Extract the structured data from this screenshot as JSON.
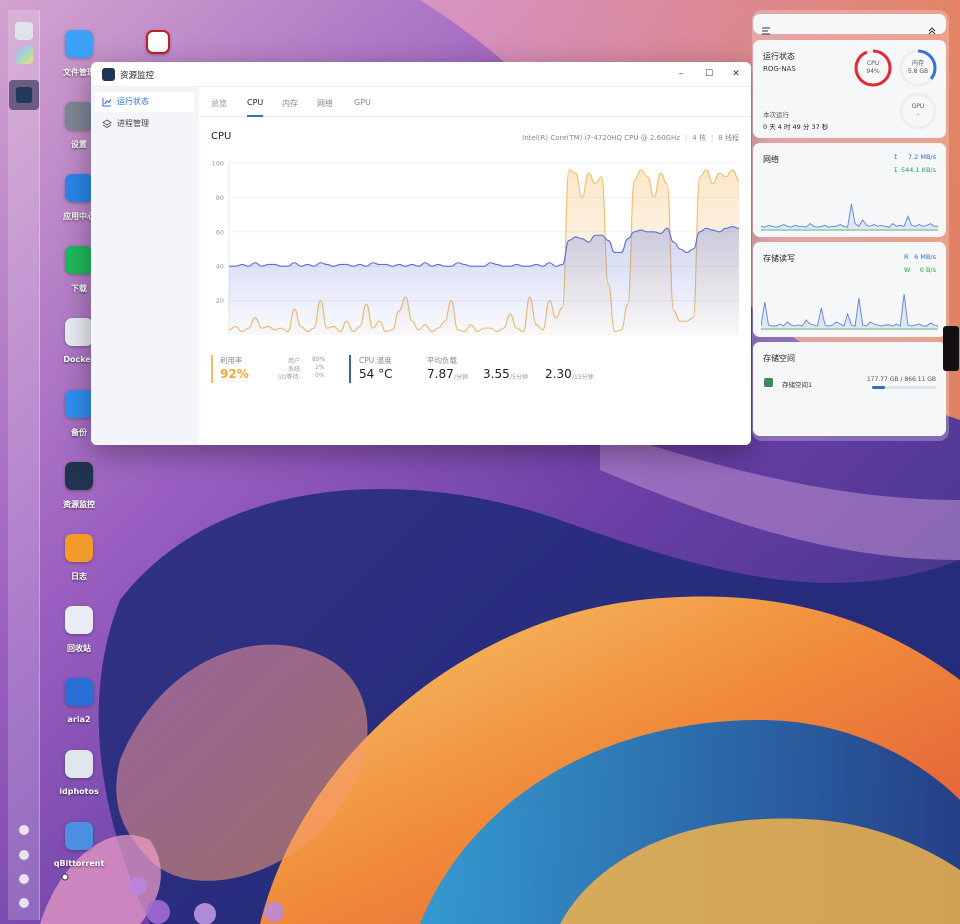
{
  "window": {
    "title": "资源监控",
    "controls": {
      "minimize": "–",
      "maximize": "☐",
      "close": "✕"
    }
  },
  "sidebar": {
    "items": [
      {
        "label": "运行状态",
        "icon": "chart-line-icon",
        "active": true
      },
      {
        "label": "进程管理",
        "icon": "layers-icon",
        "active": false
      }
    ]
  },
  "tabs": [
    {
      "label": "总览",
      "active": false
    },
    {
      "label": "CPU",
      "active": true
    },
    {
      "label": "内存",
      "active": false
    },
    {
      "label": "网络",
      "active": false
    },
    {
      "label": "GPU",
      "active": false
    }
  ],
  "cpu": {
    "title": "CPU",
    "model": "Intel(R) Core(TM) i7-4720HQ CPU @ 2.60GHz",
    "cores": "4 核",
    "threads": "8 线程",
    "usage_label": "利用率",
    "usage_value": "92%",
    "user_label": "用户:",
    "user_value": "89%",
    "system_label": "系统:",
    "system_value": "2%",
    "io_label": "I/O等待:",
    "io_value": "0%",
    "temp_label": "CPU 温度",
    "temp_value": "54 °C",
    "load_label": "平均负载",
    "load": [
      {
        "value": "7.87",
        "unit": "/分钟"
      },
      {
        "value": "3.55",
        "unit": "/5分钟"
      },
      {
        "value": "2.30",
        "unit": "/15分钟"
      }
    ]
  },
  "chart_data": {
    "type": "area",
    "y_ticks": [
      "100",
      "80",
      "60",
      "40",
      "20"
    ],
    "ylim": [
      0,
      100
    ],
    "grid": true,
    "series": [
      {
        "color": "#f2bd6a",
        "values": [
          3,
          5,
          2,
          4,
          10,
          4,
          5,
          3,
          4,
          2,
          15,
          5,
          2,
          4,
          20,
          4,
          5,
          2,
          8,
          2,
          5,
          18,
          4,
          8,
          2,
          3,
          14,
          22,
          8,
          3,
          6,
          2,
          4,
          8,
          20,
          3,
          2,
          6,
          2,
          4,
          4,
          2,
          4,
          12,
          4,
          2,
          22,
          6,
          3,
          20,
          10,
          16,
          96,
          94,
          80,
          94,
          88,
          92,
          30,
          2,
          3,
          18,
          90,
          96,
          92,
          80,
          94,
          88,
          14,
          8,
          8,
          10,
          92,
          96,
          88,
          94,
          92,
          96,
          90
        ]
      },
      {
        "color": "#5b6fd9",
        "values": [
          40,
          40,
          41,
          40,
          42,
          40,
          41,
          41,
          40,
          40,
          42,
          40,
          41,
          40,
          42,
          41,
          40,
          41,
          41,
          40,
          41,
          40,
          42,
          41,
          41,
          40,
          41,
          40,
          41,
          40,
          42,
          40,
          41,
          40,
          40,
          42,
          41,
          40,
          40,
          40,
          42,
          41,
          40,
          40,
          41,
          40,
          40,
          41,
          40,
          42,
          40,
          41,
          55,
          57,
          56,
          54,
          58,
          58,
          55,
          48,
          48,
          56,
          60,
          61,
          60,
          60,
          59,
          62,
          54,
          50,
          48,
          50,
          60,
          62,
          61,
          60,
          62,
          63,
          62
        ]
      }
    ]
  },
  "desktop": {
    "icons": [
      {
        "label": "文件管理",
        "icon": "folder-icon",
        "color": "#3da2f5"
      },
      {
        "label": "设置",
        "icon": "gear-icon",
        "color": "#7d8794"
      },
      {
        "label": "应用中心",
        "icon": "store-icon",
        "color": "#2a86e8"
      },
      {
        "label": "下载",
        "icon": "download-icon",
        "color": "#1fb85c"
      },
      {
        "label": "Docker",
        "icon": "docker-icon",
        "color": "#e8ecf2"
      },
      {
        "label": "备份",
        "icon": "backup-icon",
        "color": "#2f8ff0"
      },
      {
        "label": "资源监控",
        "icon": "monitor-icon",
        "color": "#22334f"
      },
      {
        "label": "日志",
        "icon": "log-icon",
        "color": "#f29a2a"
      },
      {
        "label": "回收站",
        "icon": "recycle-bin-icon",
        "color": "#e9edf3"
      },
      {
        "label": "aria2",
        "icon": "aria2-icon",
        "color": "#2a6fd6"
      },
      {
        "label": "idphotos",
        "icon": "idphotos-icon",
        "color": "#dfe6ee"
      },
      {
        "label": "qBittorrent",
        "icon": "qbittorrent-icon",
        "color": "#4a8fe0"
      }
    ]
  },
  "widgets": {
    "status": {
      "title": "运行状态",
      "host": "ROG-NAS",
      "uptime_label": "本次运行",
      "uptime": "0 天 4 时 49 分 37 秒",
      "cpu_label": "CPU",
      "cpu_value": "94%",
      "cpu_fraction": 0.94,
      "mem_label": "内存",
      "mem_value": "5.8 GB",
      "mem_fraction": 0.36,
      "gpu_label": "GPU",
      "gpu_value": "-"
    },
    "network": {
      "title": "网络",
      "up": "7.2 MB/s",
      "down": "544.1 KB/s",
      "values": [
        3,
        2,
        4,
        3,
        2,
        3,
        5,
        3,
        2,
        4,
        3,
        3,
        2,
        6,
        3,
        2,
        3,
        4,
        2,
        3,
        3,
        5,
        3,
        2,
        28,
        6,
        3,
        10,
        4,
        3,
        5,
        3,
        4,
        3,
        2,
        6,
        3,
        4,
        3,
        14,
        4,
        3,
        5,
        3,
        4,
        6,
        3,
        3
      ]
    },
    "disk_io": {
      "title": "存储读写",
      "read_label": "R",
      "read": "6 MB/s",
      "write_label": "W",
      "write": "0 B/s",
      "values": [
        2,
        26,
        3,
        2,
        2,
        4,
        2,
        6,
        3,
        2,
        3,
        2,
        8,
        4,
        3,
        2,
        20,
        3,
        2,
        3,
        6,
        4,
        2,
        14,
        3,
        2,
        30,
        3,
        2,
        6,
        4,
        3,
        2,
        3,
        3,
        2,
        4,
        2,
        34,
        3,
        2,
        3,
        4,
        2,
        2,
        5,
        3,
        2
      ]
    },
    "storage": {
      "title": "存储空间",
      "volume": "存储空间1",
      "used": "177.77 GB / 866.11 GB",
      "fraction": 0.205
    }
  }
}
